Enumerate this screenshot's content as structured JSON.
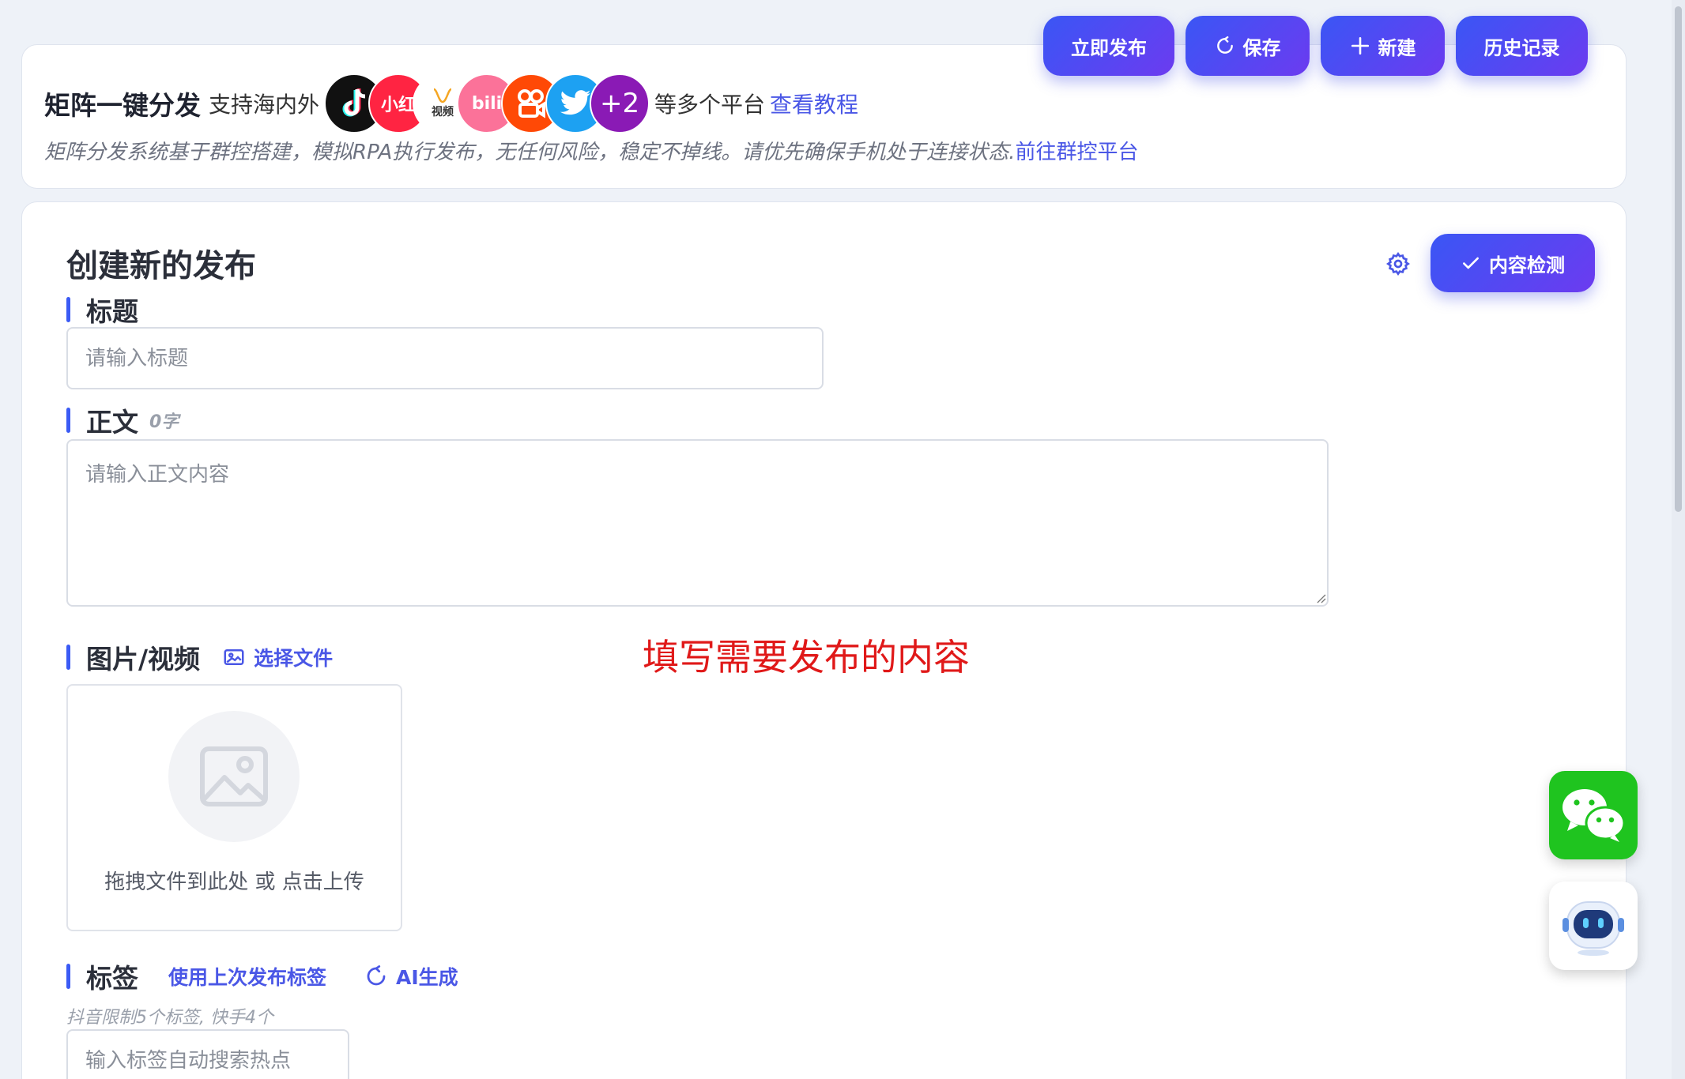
{
  "toolbar": {
    "publish_now": "立即发布",
    "save": "保存",
    "new": "新建",
    "history": "历史记录"
  },
  "intro": {
    "title": "矩阵一键分发",
    "support_prefix": "支持海内外",
    "platform_more": "+2",
    "platform_labels": [
      "小红",
      "视频",
      "bili"
    ],
    "support_suffix": "等多个平台",
    "tutorial_link": "查看教程",
    "description": "矩阵分发系统基于群控搭建，模拟RPA执行发布，无任何风险，稳定不掉线。请优先确保手机处于连接状态.",
    "platform_link": "前往群控平台"
  },
  "form": {
    "title": "创建新的发布",
    "check_button": "内容检测",
    "title_label": "标题",
    "title_placeholder": "请输入标题",
    "body_label": "正文",
    "body_count": "0字",
    "body_placeholder": "请输入正文内容",
    "media_label": "图片/视频",
    "select_file": "选择文件",
    "upload_hint": "拖拽文件到此处 或 点击上传",
    "tags_label": "标签",
    "use_last_tags": "使用上次发布标签",
    "ai_generate": "AI生成",
    "tags_hint": "抖音限制5个标签, 快手4个",
    "tags_placeholder": "输入标签自动搜索热点"
  },
  "annotation": "填写需要发布的内容",
  "colors": {
    "accent": "#3b5bf5",
    "button_gradient_start": "#3a56f5",
    "button_gradient_end": "#6c3bf0",
    "annotation": "#e01919",
    "wechat": "#1fc41f"
  }
}
